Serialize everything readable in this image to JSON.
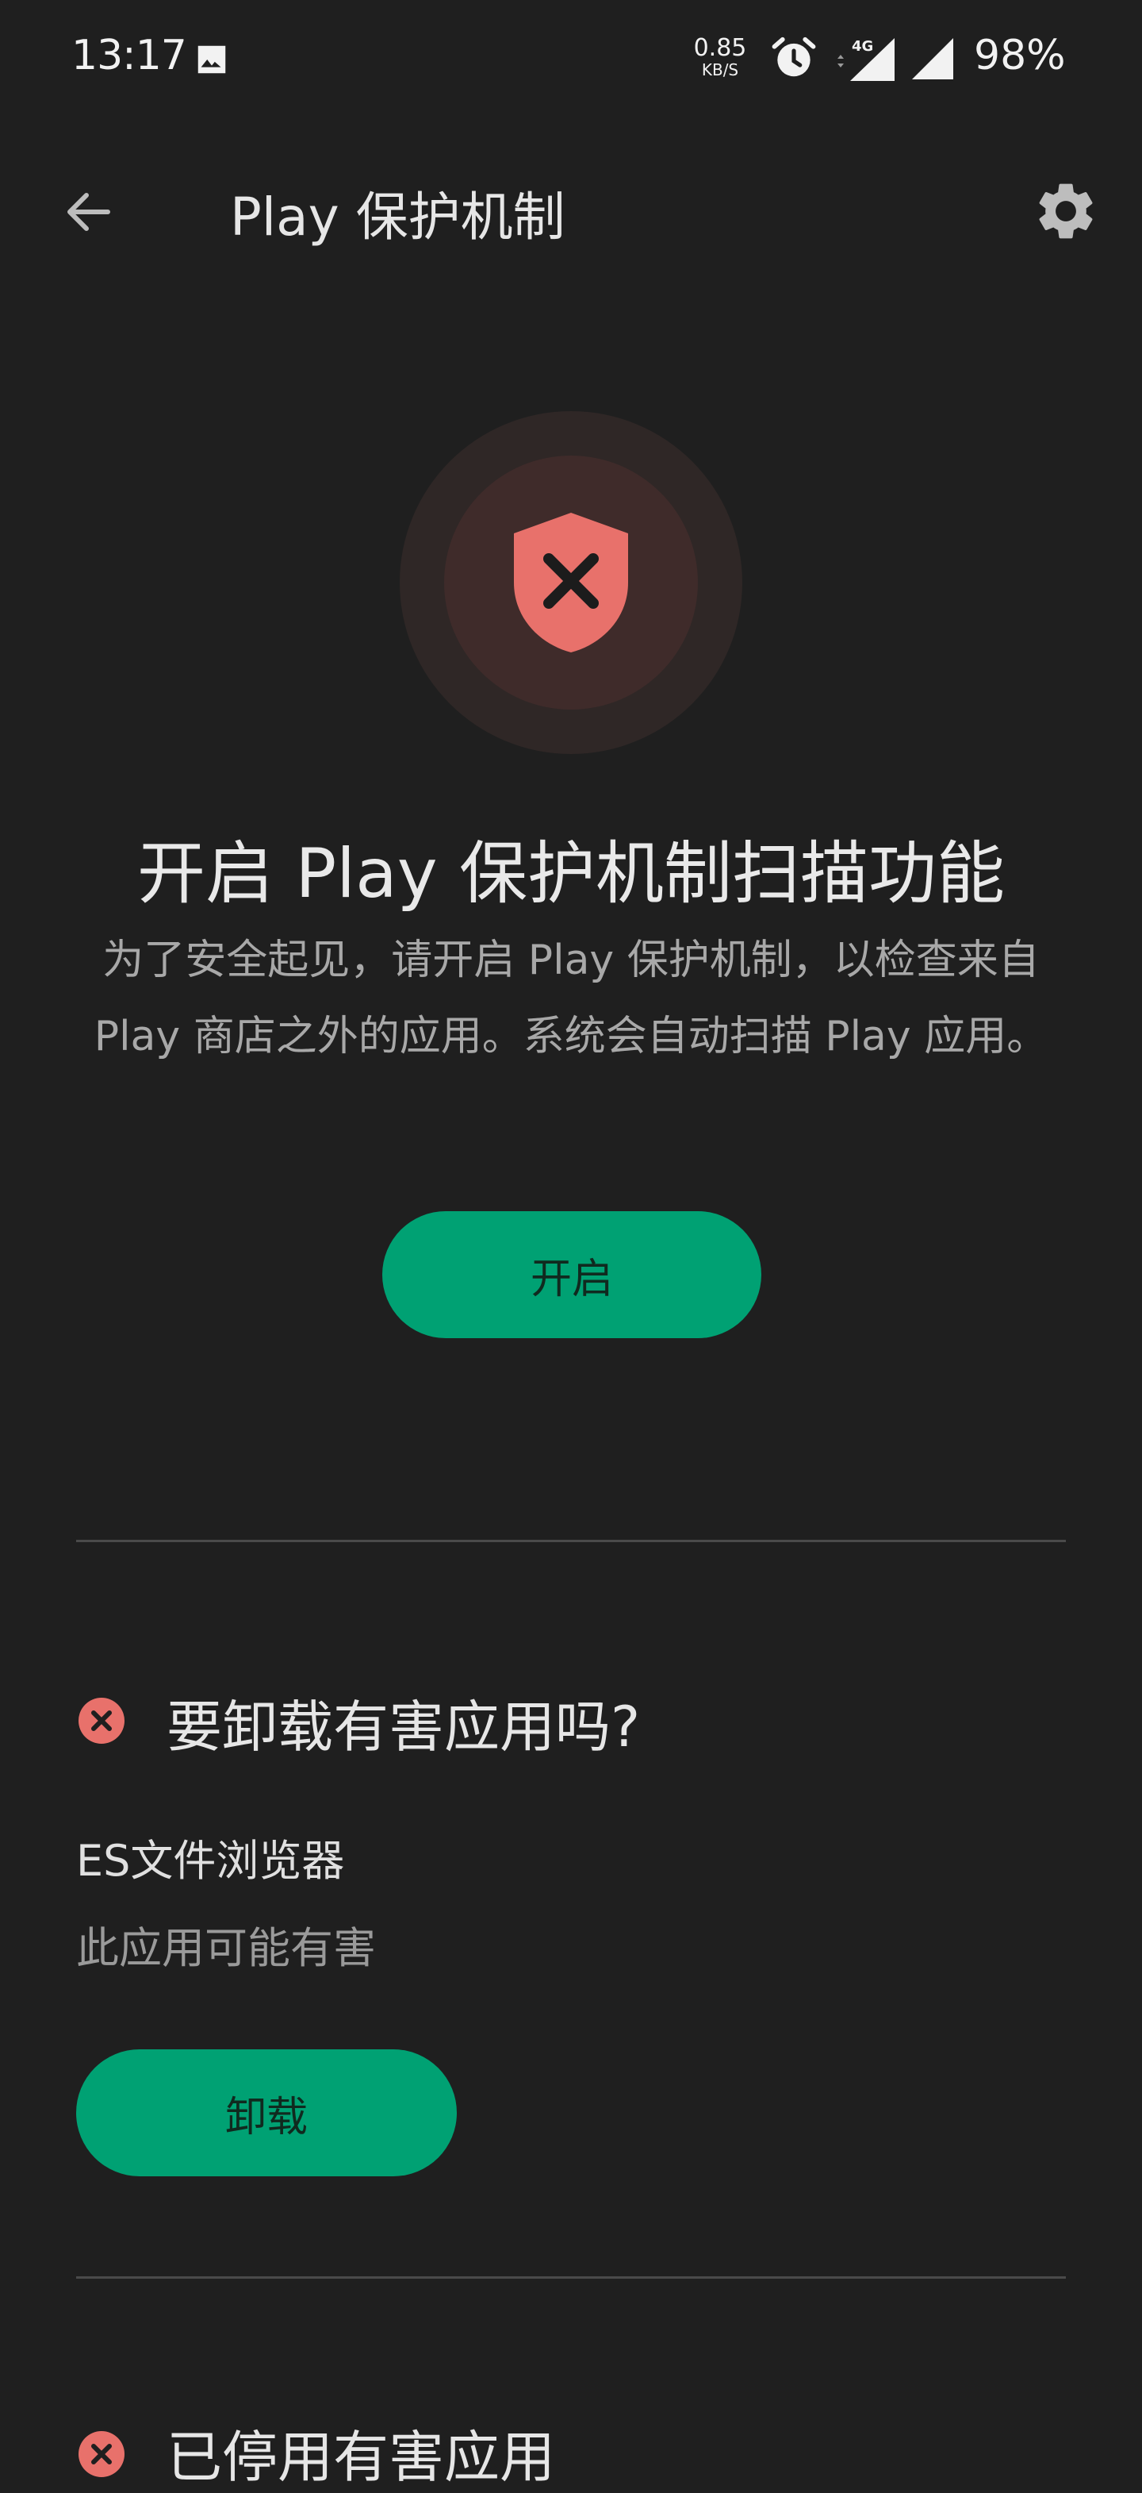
{
  "status_bar": {
    "time": "13:17",
    "net_speed_value": "0.85",
    "net_speed_unit": "KB/S",
    "network_type": "4G",
    "battery": "98%",
    "icons": [
      "image-icon",
      "alarm-icon",
      "signal-4g-icon",
      "signal-icon"
    ]
  },
  "app_bar": {
    "title": "Play 保护机制",
    "back_icon": "arrow-back-icon",
    "settings_icon": "gear-icon"
  },
  "hero": {
    "icon": "shield-x-icon",
    "title": "开启 Play 保护机制扫描功能",
    "description": "为了安全起见，请开启 Play 保护机制，以检查来自 Play 商店之外的应用。系统会自动扫描 Play 应用。",
    "button_label": "开启"
  },
  "harmful_apps_section": {
    "heading": "要卸载有害应用吗?",
    "app_name": "ES文件浏览器",
    "app_status": "此应用可能有害",
    "button_label": "卸载"
  },
  "disabled_apps_section": {
    "heading": "已停用有害应用"
  },
  "colors": {
    "background": "#1f1f1f",
    "accent_green": "#00a173",
    "error_red": "#e8716b"
  }
}
